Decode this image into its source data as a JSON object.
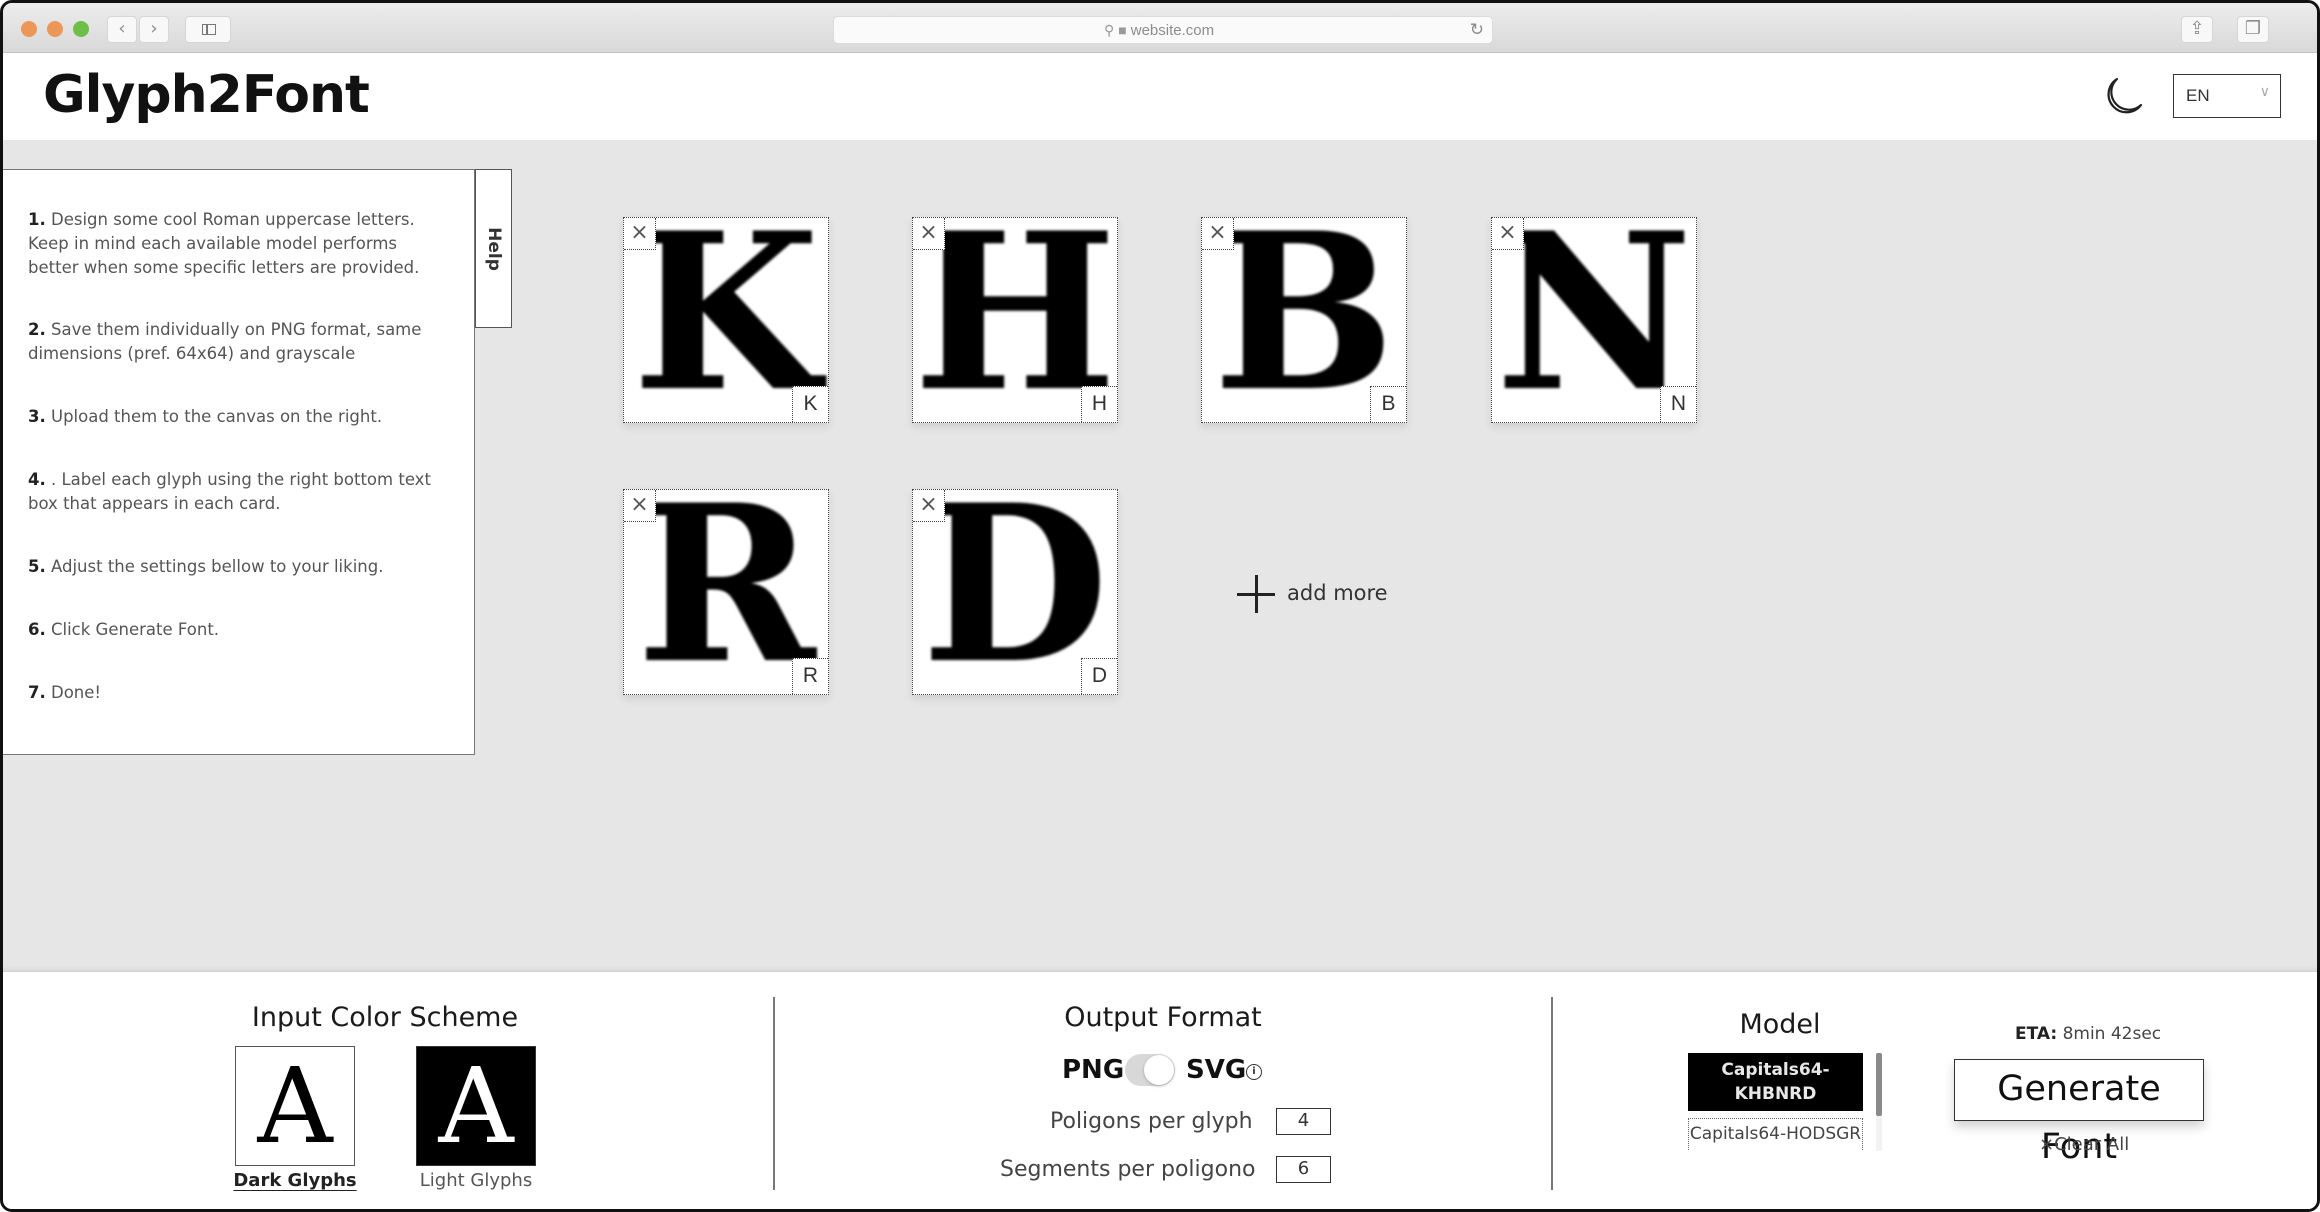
{
  "browser": {
    "url": "website.com",
    "icons": {
      "back": "chevron-left-icon",
      "forward": "chevron-right-icon",
      "sidebar": "sidebar-icon",
      "search": "search-icon",
      "lock": "lock-icon",
      "reload": "reload-icon",
      "share": "share-icon",
      "tabs": "tabs-icon"
    },
    "traffic_light_colors": [
      "#ec9657",
      "#ec9657",
      "#6cc04a"
    ]
  },
  "header": {
    "title": "Glyph2Font",
    "theme_icon": "moon-icon",
    "language": {
      "selected": "EN"
    }
  },
  "help": {
    "tab_label": "Help",
    "steps": [
      {
        "num": "1.",
        "text": " Design some cool Roman uppercase letters. Keep in mind each available model performs better when some specific letters are provided."
      },
      {
        "num": "2.",
        "text": " Save them individually on PNG format, same dimensions (pref. 64x64) and grayscale"
      },
      {
        "num": "3.",
        "text": " Upload them to the canvas on the right."
      },
      {
        "num": "4.",
        "text": " . Label each glyph using the right bottom text box that appears in each card."
      },
      {
        "num": "5.",
        "text": " Adjust the settings bellow to your liking."
      },
      {
        "num": "6.",
        "text": " Click Generate Font."
      },
      {
        "num": "7.",
        "text": " Done!"
      }
    ]
  },
  "canvas": {
    "glyphs": [
      {
        "letter": "K",
        "label": "K"
      },
      {
        "letter": "H",
        "label": "H"
      },
      {
        "letter": "B",
        "label": "B"
      },
      {
        "letter": "N",
        "label": "N"
      },
      {
        "letter": "R",
        "label": "R"
      },
      {
        "letter": "D",
        "label": "D"
      }
    ],
    "close_glyph": "×",
    "add_more_label": "add more"
  },
  "settings": {
    "color_scheme": {
      "title": "Input Color Scheme",
      "sample_letter": "A",
      "options": [
        {
          "label": "Dark Glyphs",
          "selected": true
        },
        {
          "label": "Light Glyphs",
          "selected": false
        }
      ]
    },
    "output_format": {
      "title": "Output Format",
      "left_option": "PNG",
      "right_option": "SVG",
      "selected": "SVG",
      "info_icon": "i",
      "polygons_label": "Poligons per glyph",
      "polygons_value": "4",
      "segments_label": "Segments per poligono",
      "segments_value": "6"
    },
    "model": {
      "title": "Model",
      "options": [
        {
          "label_line1": "Capitals64-",
          "label_line2": "KHBNRD",
          "selected": true
        },
        {
          "label": "Capitals64-HODSGR",
          "selected": false
        }
      ]
    },
    "eta": {
      "label": "ETA:",
      "value": " 8min 42sec"
    },
    "generate_label": "Generate Font",
    "clear_all_label": "Clear All",
    "clear_all_icon": "×"
  }
}
